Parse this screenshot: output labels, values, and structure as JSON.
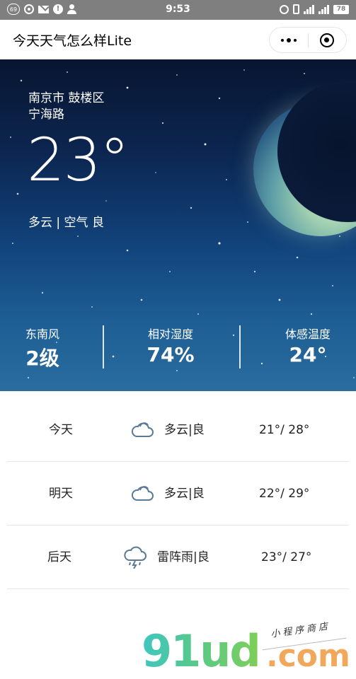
{
  "status_bar": {
    "time": "9:53",
    "notification_count": "69",
    "battery": "78",
    "left_icons": [
      "badge-icon",
      "circle-icon",
      "mail-icon",
      "chat-icon",
      "person-icon"
    ],
    "right_icons": [
      "alarm-icon",
      "vibrate-icon",
      "signal-icon",
      "signal-icon",
      "battery-icon"
    ]
  },
  "nav": {
    "title": "今天天气怎么样Lite",
    "more_icon": "more-dots-icon",
    "close_icon": "close-target-icon"
  },
  "hero": {
    "location_line1": "南京市 鼓楼区",
    "location_line2": "宁海路",
    "temperature": "23°",
    "condition": "多云 | 空气 良",
    "stats": [
      {
        "label": "东南风",
        "value": "2级"
      },
      {
        "label": "相对湿度",
        "value": "74%"
      },
      {
        "label": "体感温度",
        "value": "24°"
      }
    ],
    "moon_icon": "moon-icon"
  },
  "forecast": [
    {
      "day": "今天",
      "icon": "cloudy-icon",
      "condition": "多云|良",
      "temp": "21°/ 28°"
    },
    {
      "day": "明天",
      "icon": "cloudy-icon",
      "condition": "多云|良",
      "temp": "22°/ 29°"
    },
    {
      "day": "后天",
      "icon": "thunderstorm-icon",
      "condition": "雷阵雨|良",
      "temp": "23°/ 27°"
    }
  ],
  "watermark": {
    "main": "91ud",
    "domain": ".com",
    "tagline": "小程序商店"
  },
  "colors": {
    "status_bar": "#7f7f7f",
    "hero_top": "#081530",
    "hero_bottom": "#2a6d9f",
    "icon_stroke": "#5b7a95",
    "watermark_green": "#57c98a",
    "watermark_orange": "#f2a85b"
  }
}
